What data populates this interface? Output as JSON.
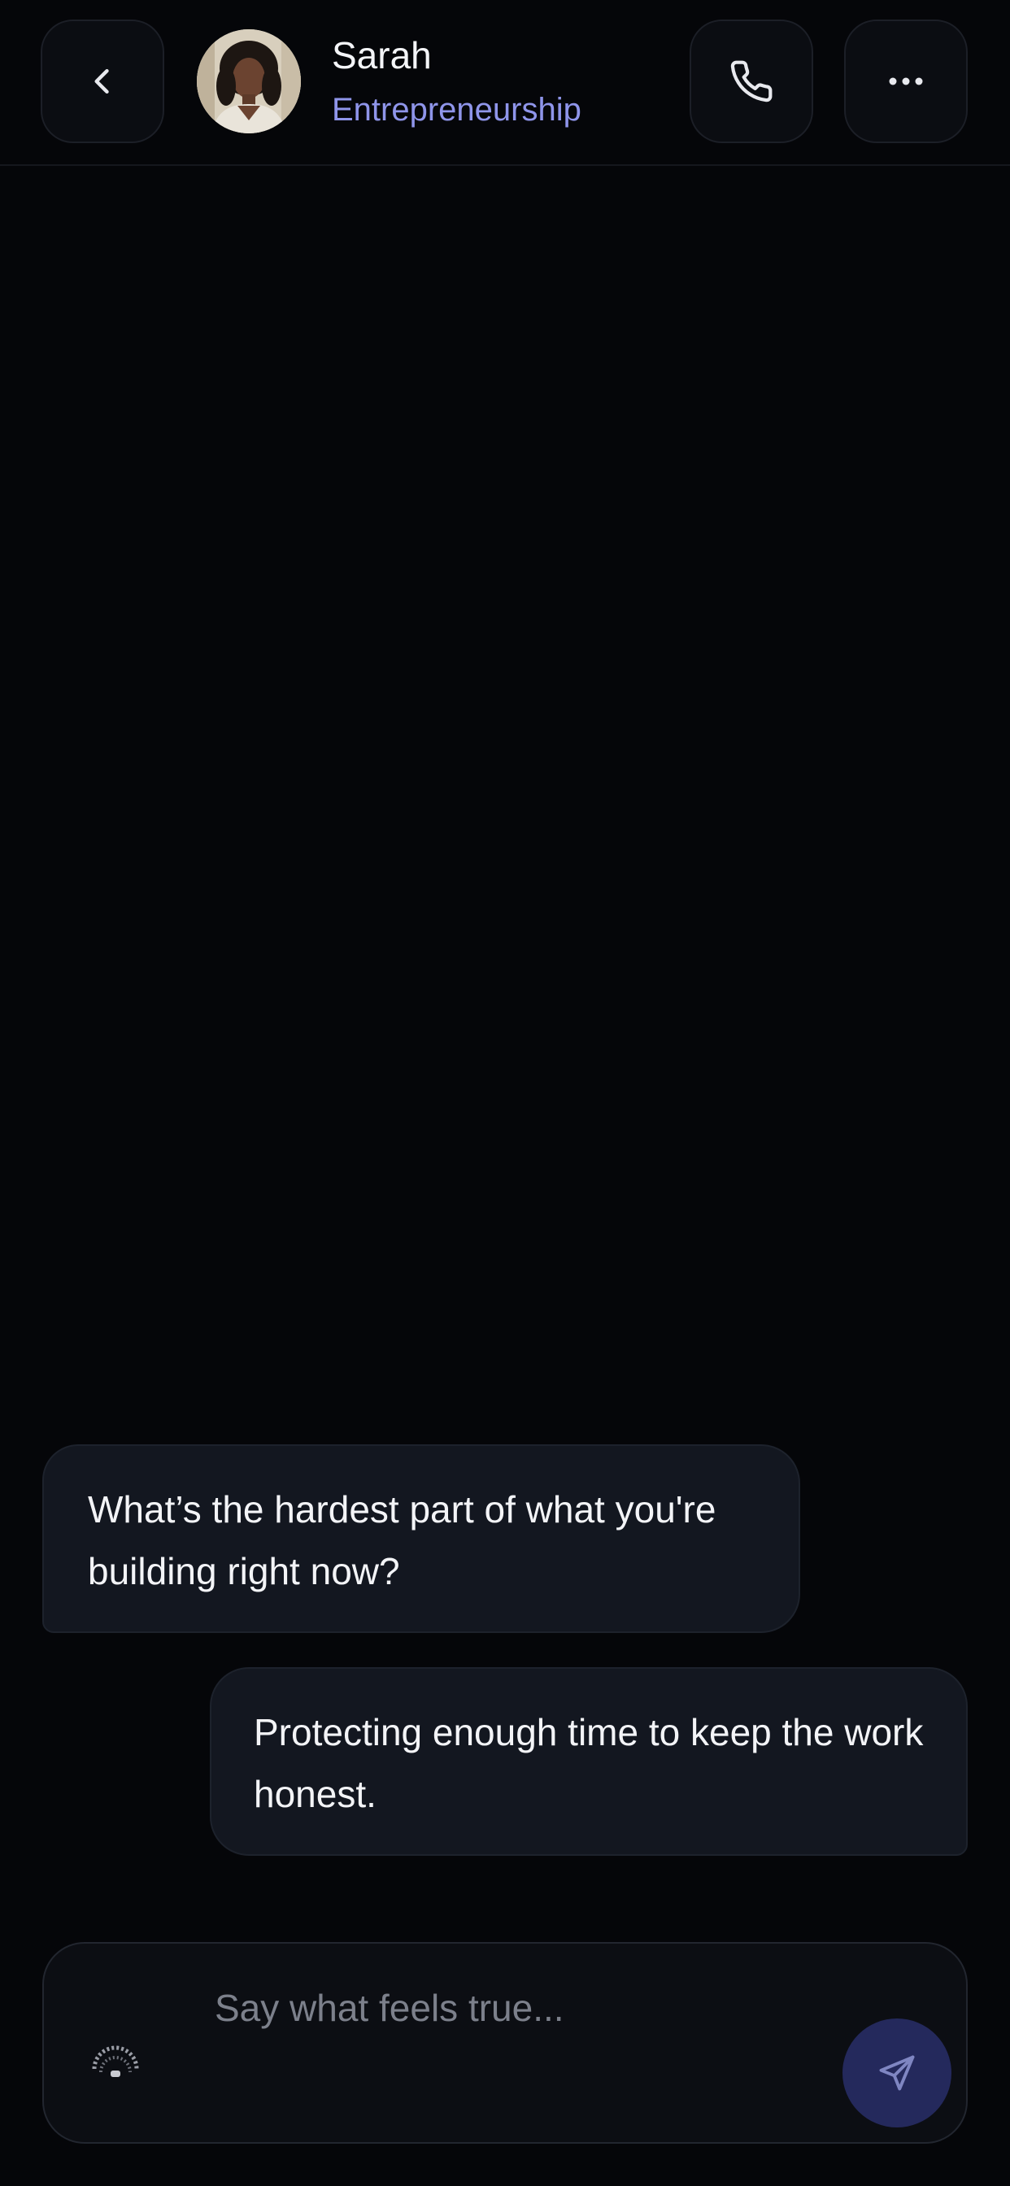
{
  "header": {
    "contact_name": "Sarah",
    "contact_subtitle": "Entrepreneurship",
    "icons": {
      "back": "chevron-left-icon",
      "call": "phone-icon",
      "more": "more-horizontal-icon"
    }
  },
  "messages": [
    {
      "sender": "Sarah",
      "direction": "incoming",
      "text": "What’s the hardest part of what you're building right now?"
    },
    {
      "sender": "me",
      "direction": "outgoing",
      "text": "Protecting enough time to keep the work honest."
    }
  ],
  "composer": {
    "value": "",
    "placeholder": "Say what feels true...",
    "send_icon": "send-icon",
    "status_icon": "loading-indicator-icon"
  },
  "colors": {
    "background": "#050609",
    "bubble": "#131720",
    "accent_text": "#8f95ea",
    "send_button": "#24295c"
  }
}
